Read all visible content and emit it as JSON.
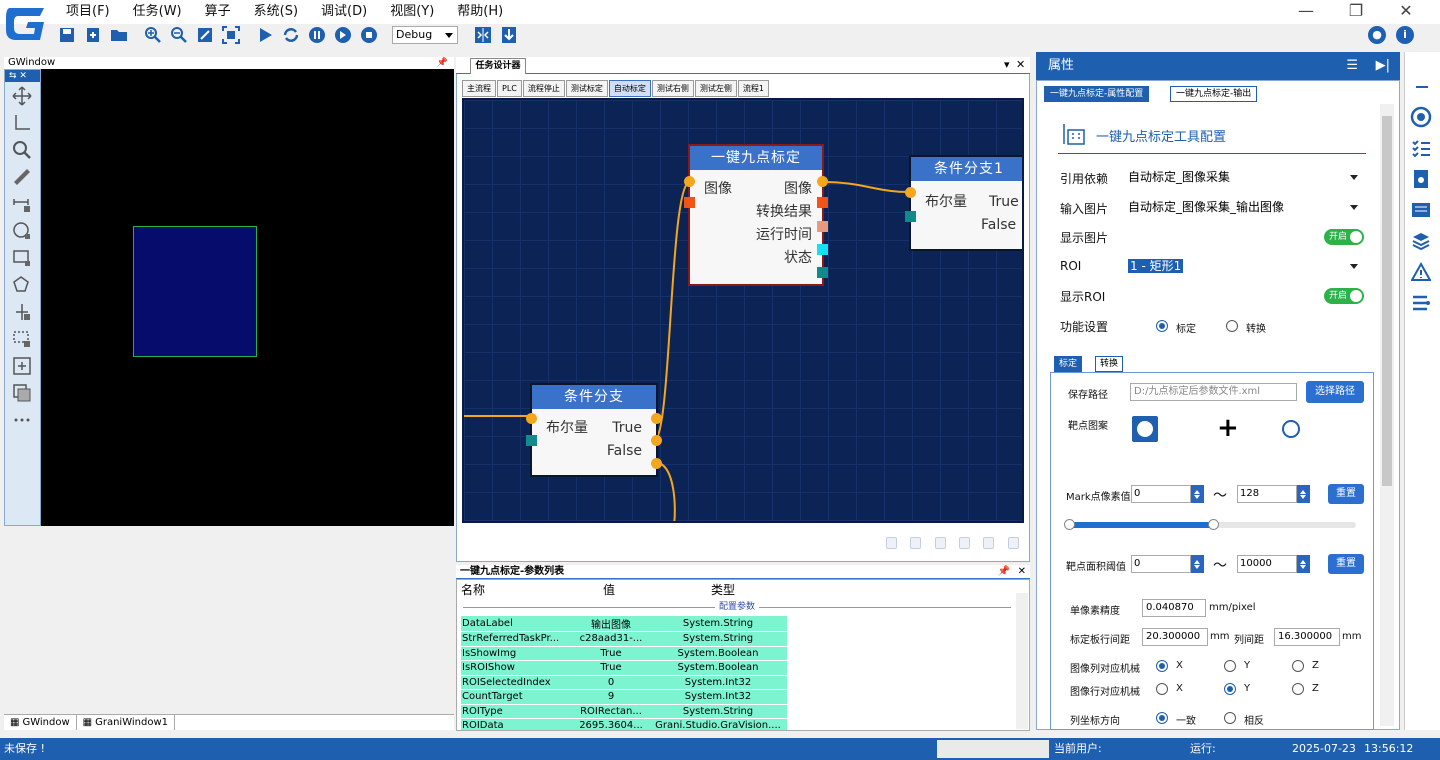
{
  "menu": [
    "项目(F)",
    "任务(W)",
    "算子",
    "系统(S)",
    "调试(D)",
    "视图(Y)",
    "帮助(H)"
  ],
  "toolbar": {
    "debug_mode": "Debug"
  },
  "gwindow": {
    "title": "GWindow",
    "tabs": [
      "GWindow",
      "GraniWindow1"
    ]
  },
  "designer": {
    "title": "任务设计器",
    "tabs": [
      "主流程",
      "PLC",
      "流程停止",
      "测试标定",
      "自动标定",
      "测试右侧",
      "测试左侧",
      "流程1"
    ],
    "active_tab": "自动标定",
    "nodes": {
      "calib": {
        "title": "一键九点标定",
        "in": "图像",
        "outs": [
          "图像",
          "转换结果",
          "运行时间",
          "状态"
        ]
      },
      "branch1": {
        "title": "条件分支1",
        "in": "布尔量",
        "outs": [
          "True",
          "False"
        ]
      },
      "branch": {
        "title": "条件分支",
        "in": "布尔量",
        "outs": [
          "True",
          "False"
        ]
      }
    }
  },
  "param_list": {
    "title": "一键九点标定-参数列表",
    "columns": [
      "名称",
      "值",
      "类型"
    ],
    "group": "配置参数",
    "rows": [
      [
        "DataLabel",
        "输出图像",
        "System.String"
      ],
      [
        "StrReferredTaskPr...",
        "c28aad31-...",
        "System.String"
      ],
      [
        "IsShowImg",
        "True",
        "System.Boolean"
      ],
      [
        "IsROIShow",
        "True",
        "System.Boolean"
      ],
      [
        "ROISelectedIndex",
        "0",
        "System.Int32"
      ],
      [
        "CountTarget",
        "9",
        "System.Int32"
      ],
      [
        "ROIType",
        "ROIRectan...",
        "System.String"
      ],
      [
        "ROIData",
        "2695.3604...",
        "Grani.Studio.GraVision...."
      ]
    ]
  },
  "props": {
    "header": "属性",
    "tabs": [
      "一键九点标定-属性配置",
      "一键九点标定-输出"
    ],
    "title": "一键九点标定工具配置",
    "ref_label": "引用依赖",
    "ref_value": "自动标定_图像采集",
    "input_label": "输入图片",
    "input_value": "自动标定_图像采集_输出图像",
    "show_img_label": "显示图片",
    "toggle_on": "开启",
    "roi_label": "ROI",
    "roi_value": "1 - 矩形1",
    "show_roi_label": "显示ROI",
    "func_label": "功能设置",
    "func_opts": [
      "标定",
      "转换"
    ],
    "subtabs": [
      "标定",
      "转换"
    ],
    "save_label": "保存路径",
    "save_path": "D:/九点标定后参数文件.xml",
    "choose_btn": "选择路径",
    "target_label": "靶点图案",
    "mark_label": "Mark点像素值",
    "mark_min": "0",
    "mark_max": "128",
    "reset": "重置",
    "tilde": "～",
    "area_label": "靶点面积阈值",
    "area_min": "0",
    "area_max": "10000",
    "pixel_label": "单像素精度",
    "pixel_value": "0.040870",
    "pixel_unit": "mm/pixel",
    "row_label": "标定板行间距",
    "row_value": "20.300000",
    "mm": "mm",
    "col_label": "列间距",
    "col_value": "16.300000",
    "imgcol_label": "图像列对应机械",
    "imgrow_label": "图像行对应机械",
    "axes": [
      "X",
      "Y",
      "Z"
    ],
    "dir_label": "列坐标方向",
    "dir_opts": [
      "一致",
      "相反"
    ]
  },
  "status": {
    "unsaved": "未保存 !",
    "user": "当前用户:",
    "run": "运行:",
    "date": "2025-07-23",
    "time": "13:56:12"
  },
  "colors": {
    "accent": "#1e5fb0",
    "flow_bg": "#0c2356",
    "node_header": "#3a72c9",
    "wire": "#f4a71c",
    "param_row": "#7df4d0",
    "toggle": "#2db24a"
  }
}
